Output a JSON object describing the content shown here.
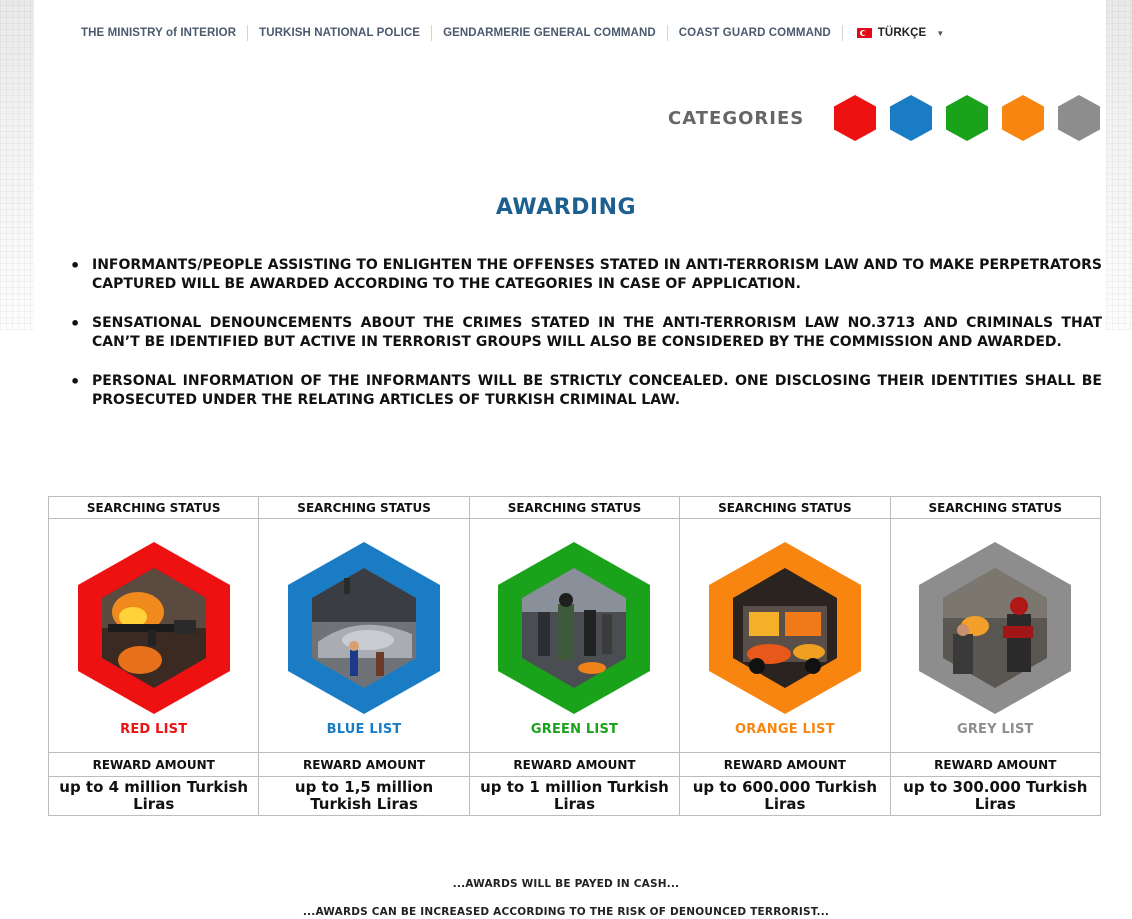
{
  "nav": {
    "links": [
      "THE MINISTRY of INTERIOR",
      "TURKISH NATIONAL POLICE",
      "GENDARMERIE GENERAL COMMAND",
      "COAST GUARD COMMAND"
    ],
    "language": "TÜRKÇE",
    "language_flag_icon": "turkey-flag-icon",
    "language_caret_icon": "caret-down-icon"
  },
  "categories": {
    "label": "CATEGORIES",
    "colors": [
      "#ee1111",
      "#1a7cc4",
      "#1aa31a",
      "#f7850f",
      "#8d8d8d"
    ]
  },
  "heading": "AWARDING",
  "bullets": [
    "INFORMANTS/PEOPLE ASSISTING TO ENLIGHTEN THE OFFENSES STATED IN ANTI-TERRORISM LAW AND TO MAKE PERPETRATORS CAPTURED WILL BE AWARDED ACCORDING TO THE CATEGORIES IN CASE OF APPLICATION.",
    "SENSATIONAL DENOUNCEMENTS ABOUT THE CRIMES STATED IN THE ANTI-TERRORISM LAW NO.3713 AND CRIMINALS THAT CAN’T BE IDENTIFIED BUT ACTIVE IN TERRORIST GROUPS WILL ALSO BE CONSIDERED BY THE COMMISSION AND AWARDED.",
    "PERSONAL INFORMATION OF THE INFORMANTS WILL BE STRICTLY CONCEALED. ONE DISCLOSING THEIR IDENTITIES SHALL BE PROSECUTED UNDER THE RELATING ARTICLES OF TURKISH CRIMINAL LAW."
  ],
  "lists": [
    {
      "status": "SEARCHING STATUS",
      "name": "RED LIST",
      "color": "#ee1111",
      "reward_label": "REWARD AMOUNT",
      "reward": "up to 4 million Turkish Liras"
    },
    {
      "status": "SEARCHING STATUS",
      "name": "BLUE LIST",
      "color": "#1a7cc4",
      "reward_label": "REWARD AMOUNT",
      "reward": "up to 1,5 million Turkish Liras"
    },
    {
      "status": "SEARCHING STATUS",
      "name": "GREEN LIST",
      "color": "#1aa31a",
      "reward_label": "REWARD AMOUNT",
      "reward": "up to 1 million Turkish Liras"
    },
    {
      "status": "SEARCHING STATUS",
      "name": "ORANGE LIST",
      "color": "#f7850f",
      "reward_label": "REWARD AMOUNT",
      "reward": "up to 600.000 Turkish Liras"
    },
    {
      "status": "SEARCHING STATUS",
      "name": "GREY LIST",
      "color": "#8d8d8d",
      "reward_label": "REWARD AMOUNT",
      "reward": "up to 300.000 Turkish Liras"
    }
  ],
  "notes": [
    "...AWARDS WILL BE PAYED IN CASH...",
    "...AWARDS CAN BE INCREASED ACCORDING TO THE RISK OF DENOUNCED TERRORIST..."
  ]
}
